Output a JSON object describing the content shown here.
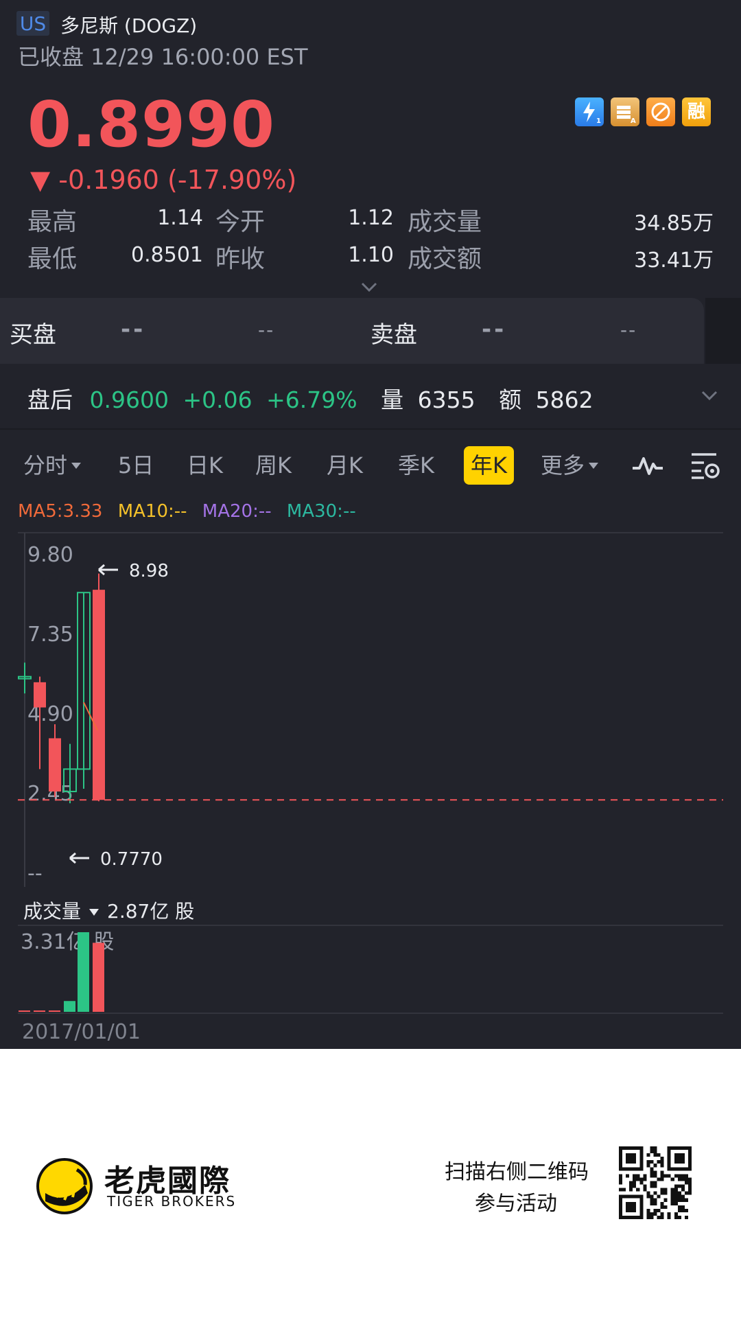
{
  "header": {
    "market_badge": "US",
    "stock_name": "多尼斯 (DOGZ)",
    "status": "已收盘 12/29 16:00:00 EST"
  },
  "quote": {
    "price": "0.8990",
    "change": "▼ -0.1960 (-17.90%)",
    "up_color": "#f2555a",
    "down_color": "#2cc486"
  },
  "badges": [
    "level1-badge",
    "education-badge",
    "no-short-badge",
    "margin-badge"
  ],
  "badge_text": {
    "margin": "融"
  },
  "stats": {
    "row1": [
      {
        "label": "最高",
        "value": "1.14"
      },
      {
        "label": "今开",
        "value": "1.12"
      },
      {
        "label": "成交量",
        "value": "34.85万"
      }
    ],
    "row2": [
      {
        "label": "最低",
        "value": "0.8501"
      },
      {
        "label": "昨收",
        "value": "1.10"
      },
      {
        "label": "成交额",
        "value": "33.41万"
      }
    ]
  },
  "order_book": {
    "bid_label": "买盘",
    "bid_price": "--",
    "bid_size": "--",
    "ask_label": "卖盘",
    "ask_price": "--",
    "ask_size": "--"
  },
  "after_hours": {
    "label": "盘后",
    "price": "0.9600",
    "change": "+0.06",
    "percent": "+6.79%",
    "volume_label": "量",
    "volume": "6355",
    "amount_label": "额",
    "amount": "5862"
  },
  "tabs": [
    {
      "label": "分时",
      "has_dropdown": true
    },
    {
      "label": "5日"
    },
    {
      "label": "日K"
    },
    {
      "label": "周K"
    },
    {
      "label": "月K"
    },
    {
      "label": "季K"
    },
    {
      "label": "年K",
      "active": true
    },
    {
      "label": "更多",
      "has_dropdown": true
    }
  ],
  "tab_icons": [
    "indicator-wave-icon",
    "chart-settings-icon"
  ],
  "ma_legend": [
    {
      "text": "MA5:3.33",
      "color": "#f06a3a"
    },
    {
      "text": "MA10:--",
      "color": "#f4c12a"
    },
    {
      "text": "MA20:--",
      "color": "#a473e6"
    },
    {
      "text": "MA30:--",
      "color": "#2cb8a0"
    }
  ],
  "chart_data": {
    "type": "candlestick",
    "y_ticks": [
      "9.80",
      "7.35",
      "4.90",
      "2.45",
      "--"
    ],
    "ylim": [
      0,
      9.8
    ],
    "high_marker": "8.98",
    "low_marker": "0.7770",
    "current_price_line": 0.899,
    "candles": [
      {
        "open": 5.3,
        "close": 5.3,
        "high": 5.8,
        "low": 4.7,
        "dir": "up"
      },
      {
        "open": 4.2,
        "close": 5.1,
        "high": 5.3,
        "low": 2.0,
        "dir": "down"
      },
      {
        "open": 1.2,
        "close": 3.1,
        "high": 3.6,
        "low": 1.0,
        "dir": "down"
      },
      {
        "open": 1.2,
        "close": 2.0,
        "high": 2.9,
        "low": 0.78,
        "dir": "up"
      },
      {
        "open": 2.0,
        "close": 8.3,
        "high": 8.3,
        "low": 1.3,
        "dir": "up"
      },
      {
        "open": 8.4,
        "close": 0.9,
        "high": 8.98,
        "low": 0.85,
        "dir": "down"
      }
    ],
    "ma5_segment": [
      3.4,
      2.9
    ]
  },
  "volume": {
    "label": "成交量",
    "value": "2.87亿 股",
    "max_label": "3.31亿 股",
    "bars": [
      {
        "value": 0.004,
        "dir": "down"
      },
      {
        "value": 0.004,
        "dir": "down"
      },
      {
        "value": 0.01,
        "dir": "down"
      },
      {
        "value": 0.45,
        "dir": "up"
      },
      {
        "value": 3.31,
        "dir": "up"
      },
      {
        "value": 2.87,
        "dir": "down"
      }
    ],
    "max": 3.31,
    "first_date": "2017/01/01"
  },
  "footer": {
    "brand_cn": "老虎國際",
    "brand_en": "TIGER BROKERS",
    "promo_line1": "扫描右侧二维码",
    "promo_line2": "参与活动"
  }
}
